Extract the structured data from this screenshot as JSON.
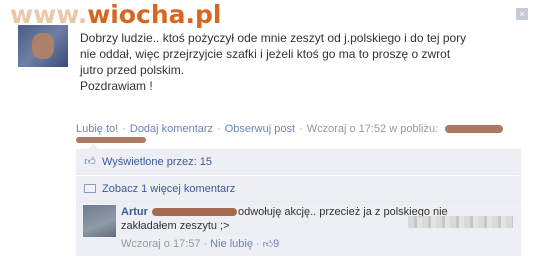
{
  "watermark": {
    "www": "www.",
    "wiocha": "wiocha",
    "pl": ".pl"
  },
  "post": {
    "close_glyph": "×",
    "line1": "Dobrzy ludzie.. ktoś pożyczył ode mnie zeszyt od j.polskiego i do tej pory",
    "line2": "nie oddał, więc przejrzyjcie szafki i jeżeli ktoś go ma to proszę o zwrot",
    "line3": "jutro przed polskim.",
    "line4": "Pozdrawiam !"
  },
  "actions": {
    "like": "Lubię to!",
    "sep": "·",
    "comment": "Dodaj komentarz",
    "follow": "Obserwuj post",
    "time": "Wczoraj o 17:52 w pobliżu:"
  },
  "ufi": {
    "seen": "Wyświetlone przez: 15",
    "more": "Zobacz 1 więcej komentarz"
  },
  "comment": {
    "author": "Artur",
    "text_a": "odwołuję akcję.. przecież ja z polskiego nie",
    "text_b": "zakładałem zeszytu ;>",
    "time": "Wczoraj o 17:57",
    "sep": "·",
    "unlike": "Nie lubię",
    "likes": "9"
  }
}
